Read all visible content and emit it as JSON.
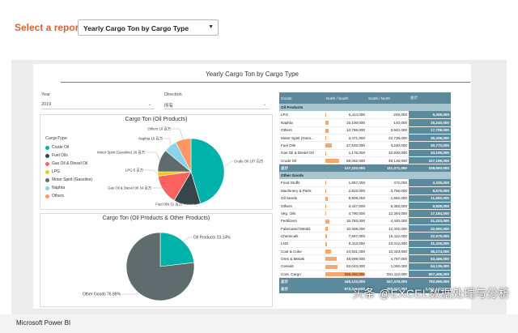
{
  "header": {
    "select_label": "Select a report:",
    "selected_report": "Yearly Cargo Ton by Cargo Type"
  },
  "report": {
    "title": "Yearly Cargo Ton by Cargo Type",
    "slicers": {
      "year_label": "Year",
      "year_value": "2019",
      "direction_label": "Direction",
      "direction_value": "所有"
    }
  },
  "footer": {
    "brand": "Microsoft Power BI",
    "watermark": "头条 @EXCEL数据处理与分析"
  },
  "colors": {
    "accent_orange": "#d4633c",
    "table_header": "#5a8a9c",
    "table_group": "#a8c6cf",
    "databar": "#f5a76c"
  },
  "legend": {
    "title": "CargoType",
    "items": [
      {
        "label": "Crude Oil",
        "color": "#00b2a9"
      },
      {
        "label": "Fuel Oils",
        "color": "#374649"
      },
      {
        "label": "Gas Oil & Diesel Oil",
        "color": "#fd625e"
      },
      {
        "label": "LPG",
        "color": "#f2c80f"
      },
      {
        "label": "Motor Spirit (Gasoline)",
        "color": "#5f6b6d"
      },
      {
        "label": "Naphta",
        "color": "#8ad4eb"
      },
      {
        "label": "Others",
        "color": "#fe9666"
      }
    ]
  },
  "table": {
    "headers": [
      "Goods",
      "North / South",
      "South / North",
      "总计"
    ],
    "groups": [
      {
        "name": "Oil Products",
        "rows": [
          {
            "goods": "LPG",
            "ns": "5,114,000",
            "sn": "245,000",
            "total": "5,359,000",
            "bar": 0.03
          },
          {
            "goods": "Naphta",
            "ns": "15,100,000",
            "sn": "140,000",
            "total": "15,240,000",
            "bar": 0.08
          },
          {
            "goods": "Others",
            "ns": "13,766,000",
            "sn": "3,942,000",
            "total": "17,708,000",
            "bar": 0.08
          },
          {
            "goods": "Motor Spirit (Gaso...",
            "ns": "3,471,000",
            "sn": "22,738,000",
            "total": "26,209,000",
            "bar": 0.02
          },
          {
            "goods": "Fuel Oils",
            "ns": "27,533,000",
            "sn": "3,240,000",
            "total": "30,773,000",
            "bar": 0.16
          },
          {
            "goods": "Gas Oil & Diesel Oil",
            "ns": "1,176,000",
            "sn": "32,930,000",
            "total": "34,106,000",
            "bar": 0.01
          },
          {
            "goods": "Crude Oil",
            "ns": "59,062,000",
            "sn": "48,136,000",
            "total": "107,198,000",
            "bar": 0.35
          }
        ],
        "subtotal": {
          "label": "总计",
          "ns": "127,222,000",
          "sn": "111,371,000",
          "total": "238,593,000"
        }
      },
      {
        "name": "Other Goods",
        "rows": [
          {
            "goods": "Food Stuffs",
            "ns": "1,867,000",
            "sn": "472,000",
            "total": "2,339,000",
            "bar": 0.01
          },
          {
            "goods": "Machinery & Parts",
            "ns": "2,823,000",
            "sn": "3,756,000",
            "total": "6,579,000",
            "bar": 0.02
          },
          {
            "goods": "Oil Seeds",
            "ns": "9,908,000",
            "sn": "1,692,000",
            "total": "11,600,000",
            "bar": 0.06
          },
          {
            "goods": "Others",
            "ns": "3,447,000",
            "sn": "6,382,000",
            "total": "9,829,000",
            "bar": 0.02
          },
          {
            "goods": "Veg. Oils",
            "ns": "4,790,000",
            "sn": "12,394,000",
            "total": "17,184,000",
            "bar": 0.03
          },
          {
            "goods": "Fertilizers",
            "ns": "16,783,000",
            "sn": "4,440,000",
            "total": "21,223,000",
            "bar": 0.1
          },
          {
            "goods": "Fabricated Metals",
            "ns": "10,558,000",
            "sn": "12,402,000",
            "total": "22,960,000",
            "bar": 0.06
          },
          {
            "goods": "Chemicals",
            "ns": "7,867,000",
            "sn": "15,112,000",
            "total": "22,979,000",
            "bar": 0.05
          },
          {
            "goods": "LNG",
            "ns": "8,113,000",
            "sn": "23,312,000",
            "total": "31,425,000",
            "bar": 0.05
          },
          {
            "goods": "Coal & Coke",
            "ns": "24,931,000",
            "sn": "10,343,000",
            "total": "35,274,000",
            "bar": 0.15
          },
          {
            "goods": "Ores & Metals",
            "ns": "48,699,000",
            "sn": "4,787,000",
            "total": "53,486,000",
            "bar": 0.29
          },
          {
            "goods": "Cereals",
            "ns": "53,043,000",
            "sn": "1,092,000",
            "total": "54,135,000",
            "bar": 0.31
          },
          {
            "goods": "Cont. Cargo",
            "ns": "256,294,000",
            "sn": "251,112,000",
            "total": "507,406,000",
            "bar": 1.0
          }
        ],
        "subtotal": {
          "label": "总计",
          "ns": "445,123,000",
          "sn": "347,476,000",
          "total": "792,599,000"
        }
      }
    ],
    "grand_total": {
      "label": "总计",
      "ns": "572,345,000",
      "sn": "458,847,000",
      "total": "1,031,192,000"
    }
  },
  "chart_data": [
    {
      "type": "pie",
      "title": "Cargo Ton (Oil Products)",
      "slices": [
        {
          "name": "Crude Oil",
          "label": "Crude Oil 107 百万",
          "value": 107,
          "color": "#00b2a9"
        },
        {
          "name": "Fuel Oils",
          "label": "Fuel Oils 31 百万",
          "value": 31,
          "color": "#374649"
        },
        {
          "name": "Gas Oil & Diesel Oil",
          "label": "Gas Oil & Diesel Oil 34 百万",
          "value": 34,
          "color": "#fd625e"
        },
        {
          "name": "LPG",
          "label": "LPG 5 百万",
          "value": 5,
          "color": "#f2c80f"
        },
        {
          "name": "Motor Spirit (Gasoline)",
          "label": "Motor Spirit (Gasoline) 26 百万",
          "value": 26,
          "color": "#5f6b6d"
        },
        {
          "name": "Naphta",
          "label": "Naphta 15 百万",
          "value": 15,
          "color": "#8ad4eb"
        },
        {
          "name": "Others",
          "label": "Others 18 百万",
          "value": 18,
          "color": "#fe9666"
        }
      ]
    },
    {
      "type": "pie",
      "title": "Cargo Ton (Oil Products & Other Products)",
      "slices": [
        {
          "name": "Oil Products",
          "label": "Oil Products 23.14%",
          "value": 23.14,
          "color": "#00b2a9"
        },
        {
          "name": "Other Goods",
          "label": "Other Goods 76.86%",
          "value": 76.86,
          "color": "#5f6b6d"
        }
      ]
    }
  ]
}
